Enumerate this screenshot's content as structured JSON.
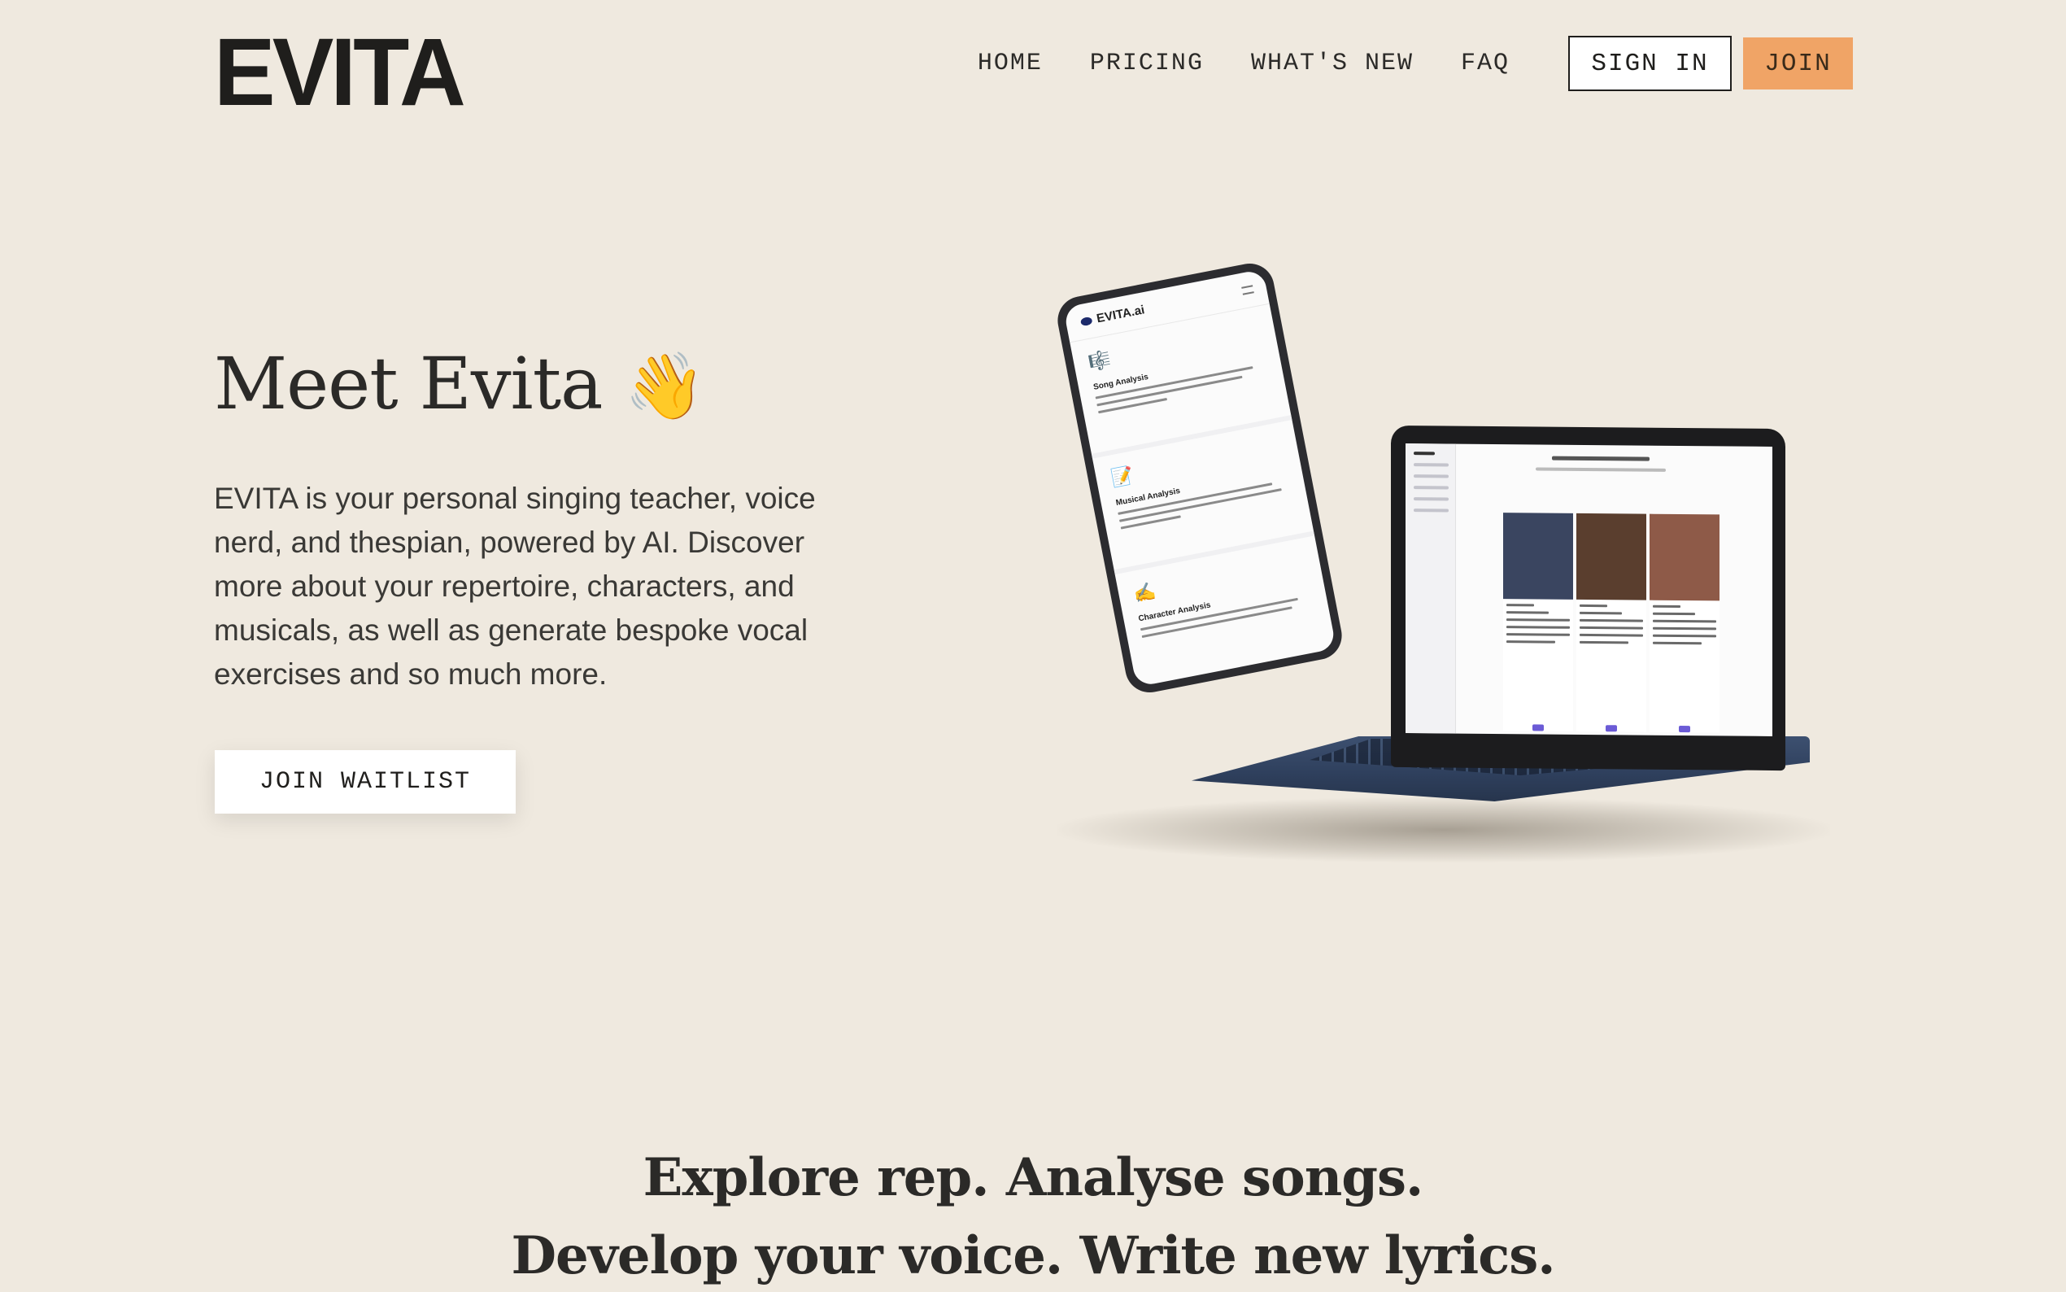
{
  "brand": {
    "logo": "EVITA"
  },
  "nav": {
    "items": [
      {
        "label": "HOME"
      },
      {
        "label": "PRICING"
      },
      {
        "label": "WHAT'S NEW"
      },
      {
        "label": "FAQ"
      }
    ],
    "signin_label": "SIGN IN",
    "join_label": "JOIN"
  },
  "hero": {
    "title": "Meet Evita",
    "title_emoji": "👋",
    "description": "EVITA is your personal singing teacher, voice nerd, and thespian, powered by AI. Discover more about your repertoire, characters, and musicals, as well as generate bespoke vocal exercises and so much more.",
    "cta_label": "JOIN WAITLIST"
  },
  "mockup": {
    "phone_brand": "EVITA.ai",
    "phone_sections": [
      {
        "icon": "sheet-music-icon",
        "glyph": "🎼",
        "title": "Song Analysis"
      },
      {
        "icon": "notebook-icon",
        "glyph": "📝",
        "title": "Musical Analysis"
      },
      {
        "icon": "writing-hand-icon",
        "glyph": "✍",
        "title": "Character Analysis"
      }
    ],
    "laptop_portraits": [
      {
        "bg": "#3a4560"
      },
      {
        "bg": "#5a3e2e"
      },
      {
        "bg": "#8e5a48"
      }
    ]
  },
  "tagline": {
    "line1": "Explore rep. Analyse songs.",
    "line2": "Develop your voice. Write new lyrics."
  },
  "colors": {
    "background": "#efe9df",
    "accent": "#f0a466",
    "text": "#2b2a28"
  }
}
